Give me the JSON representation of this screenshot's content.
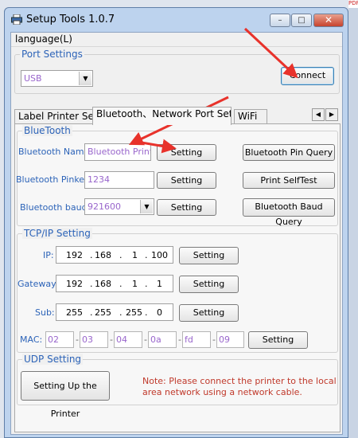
{
  "app": {
    "title": "Setup Tools 1.0.7",
    "menu": {
      "language": "language(L)"
    },
    "window_buttons": {
      "minimize": "–",
      "maximize": "□",
      "close": "✕"
    },
    "background_badge": "PDF"
  },
  "port_settings": {
    "legend": "Port Settings",
    "port_value": "USB",
    "connect_label": "Connect"
  },
  "tabs": [
    {
      "label": "Label Printer Set"
    },
    {
      "label": "Bluetooth、Network Port Set"
    },
    {
      "label": "WiFi"
    }
  ],
  "tab_scroll": {
    "left": "◀",
    "right": "▶"
  },
  "bluetooth": {
    "legend": "BlueTooth",
    "name_label": "Bluetooth Name:",
    "name_value": "Bluetooth Printer",
    "pinkey_label": "Bluetooth Pinkey:",
    "pinkey_value": "1234",
    "baud_label": "Bluetooth baud:",
    "baud_value": "921600",
    "setting_label": "Setting",
    "pin_query": "Bluetooth Pin Query",
    "print_selftest": "Print SelfTest",
    "baud_query": "Bluetooth Baud Query"
  },
  "tcpip": {
    "legend": "TCP/IP Setting",
    "ip_label": "IP:",
    "ip": [
      "192",
      "168",
      "1",
      "100"
    ],
    "gateway_label": "Gateway:",
    "gateway": [
      "192",
      "168",
      "1",
      "1"
    ],
    "sub_label": "Sub:",
    "sub": [
      "255",
      "255",
      "255",
      "0"
    ],
    "mac_label": "MAC:",
    "mac": [
      "02",
      "03",
      "04",
      "0a",
      "fd",
      "09"
    ],
    "setting_label": "Setting",
    "dot": "."
  },
  "udp": {
    "legend": "UDP Setting",
    "setup_button": "Setting Up the Printer",
    "note": "Note: Please connect the printer to the local area network using a network cable."
  },
  "colors": {
    "accent_blue": "#2c63b8",
    "value_purple": "#9966cc",
    "annotation_red": "#e8322b",
    "note_red": "#c0392b"
  }
}
